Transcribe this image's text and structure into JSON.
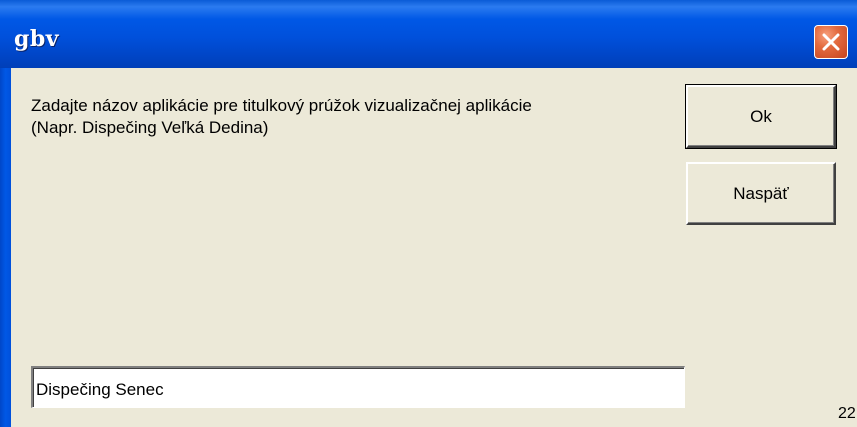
{
  "window": {
    "title": "gbv"
  },
  "prompt": {
    "line1": "Zadajte názov aplikácie pre titulkový prúžok vizualizačnej aplikácie",
    "line2": "(Napr. Dispečing Veľká Dedina)"
  },
  "buttons": {
    "ok_label": "Ok",
    "back_label": "Naspäť"
  },
  "input": {
    "value": "Dispečing Senec"
  },
  "corner_text": "22",
  "colors": {
    "titlebar": "#0058e6",
    "close_button": "#e36a3e",
    "dialog_background": "#ece9d8"
  },
  "icons": {
    "close": "close-icon"
  }
}
